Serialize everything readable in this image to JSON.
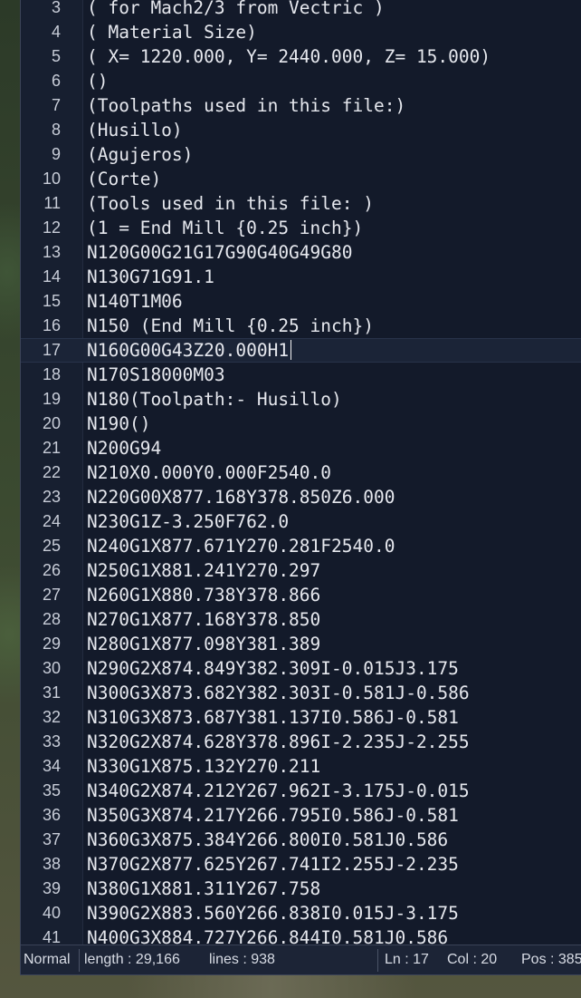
{
  "editor": {
    "lines": [
      {
        "num": "3",
        "text": "( for Mach2/3 from Vectric )"
      },
      {
        "num": "4",
        "text": "( Material Size)"
      },
      {
        "num": "5",
        "text": "( X= 1220.000, Y= 2440.000, Z= 15.000)"
      },
      {
        "num": "6",
        "text": "()"
      },
      {
        "num": "7",
        "text": "(Toolpaths used in this file:)"
      },
      {
        "num": "8",
        "text": "(Husillo)"
      },
      {
        "num": "9",
        "text": "(Agujeros)"
      },
      {
        "num": "10",
        "text": "(Corte)"
      },
      {
        "num": "11",
        "text": "(Tools used in this file: )"
      },
      {
        "num": "12",
        "text": "(1 = End Mill {0.25 inch})"
      },
      {
        "num": "13",
        "text": "N120G00G21G17G90G40G49G80"
      },
      {
        "num": "14",
        "text": "N130G71G91.1"
      },
      {
        "num": "15",
        "text": "N140T1M06"
      },
      {
        "num": "16",
        "text": "N150 (End Mill {0.25 inch})"
      },
      {
        "num": "17",
        "text": "N160G00G43Z20.000H1"
      },
      {
        "num": "18",
        "text": "N170S18000M03"
      },
      {
        "num": "19",
        "text": "N180(Toolpath:- Husillo)"
      },
      {
        "num": "20",
        "text": "N190()"
      },
      {
        "num": "21",
        "text": "N200G94"
      },
      {
        "num": "22",
        "text": "N210X0.000Y0.000F2540.0"
      },
      {
        "num": "23",
        "text": "N220G00X877.168Y378.850Z6.000"
      },
      {
        "num": "24",
        "text": "N230G1Z-3.250F762.0"
      },
      {
        "num": "25",
        "text": "N240G1X877.671Y270.281F2540.0"
      },
      {
        "num": "26",
        "text": "N250G1X881.241Y270.297"
      },
      {
        "num": "27",
        "text": "N260G1X880.738Y378.866"
      },
      {
        "num": "28",
        "text": "N270G1X877.168Y378.850"
      },
      {
        "num": "29",
        "text": "N280G1X877.098Y381.389"
      },
      {
        "num": "30",
        "text": "N290G2X874.849Y382.309I-0.015J3.175"
      },
      {
        "num": "31",
        "text": "N300G3X873.682Y382.303I-0.581J-0.586"
      },
      {
        "num": "32",
        "text": "N310G3X873.687Y381.137I0.586J-0.581"
      },
      {
        "num": "33",
        "text": "N320G2X874.628Y378.896I-2.235J-2.255"
      },
      {
        "num": "34",
        "text": "N330G1X875.132Y270.211"
      },
      {
        "num": "35",
        "text": "N340G2X874.212Y267.962I-3.175J-0.015"
      },
      {
        "num": "36",
        "text": "N350G3X874.217Y266.795I0.586J-0.581"
      },
      {
        "num": "37",
        "text": "N360G3X875.384Y266.800I0.581J0.586"
      },
      {
        "num": "38",
        "text": "N370G2X877.625Y267.741I2.255J-2.235"
      },
      {
        "num": "39",
        "text": "N380G1X881.311Y267.758"
      },
      {
        "num": "40",
        "text": "N390G2X883.560Y266.838I0.015J-3.175"
      },
      {
        "num": "41",
        "text": "N400G3X884.727Y266.844I0.581J0.586"
      }
    ],
    "current_line": "17"
  },
  "status": {
    "mode": "Normal",
    "length": "length : 29,166",
    "lines": "lines : 938",
    "ln": "Ln : 17",
    "col": "Col : 20",
    "pos": "Pos : 385"
  },
  "colors": {
    "editor_bg": "#131a2a",
    "text": "#e6e8ee",
    "current_line_bg": "#1b2437"
  }
}
